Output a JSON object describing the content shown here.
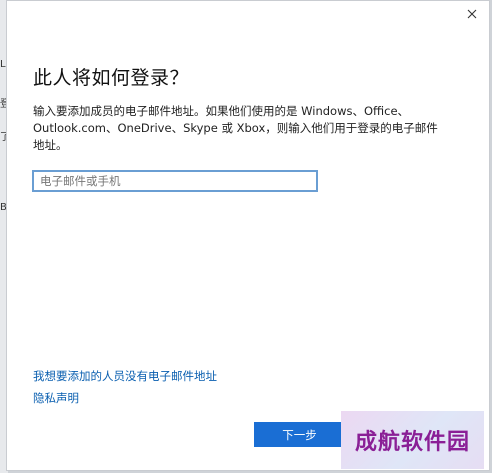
{
  "background": {
    "glyphs": [
      "L",
      "登",
      "了",
      "B"
    ]
  },
  "dialog": {
    "title": "此人将如何登录？",
    "description": "输入要添加成员的电子邮件地址。如果他们使用的是 Windows、Office、Outlook.com、OneDrive、Skype 或 Xbox，则输入他们用于登录的电子邮件地址。",
    "email_input": {
      "value": "",
      "placeholder": "电子邮件或手机"
    },
    "links": {
      "no_email": "我想要添加的人员没有电子邮件地址",
      "privacy": "隐私声明"
    },
    "next_button": "下一步",
    "close_icon": "close-icon"
  },
  "watermark": {
    "text": "成航软件园"
  },
  "colors": {
    "accent": "#1a6ed4",
    "link": "#0a5fb0",
    "input_border": "#6a9ed3",
    "watermark_text": "#8a1f96"
  }
}
